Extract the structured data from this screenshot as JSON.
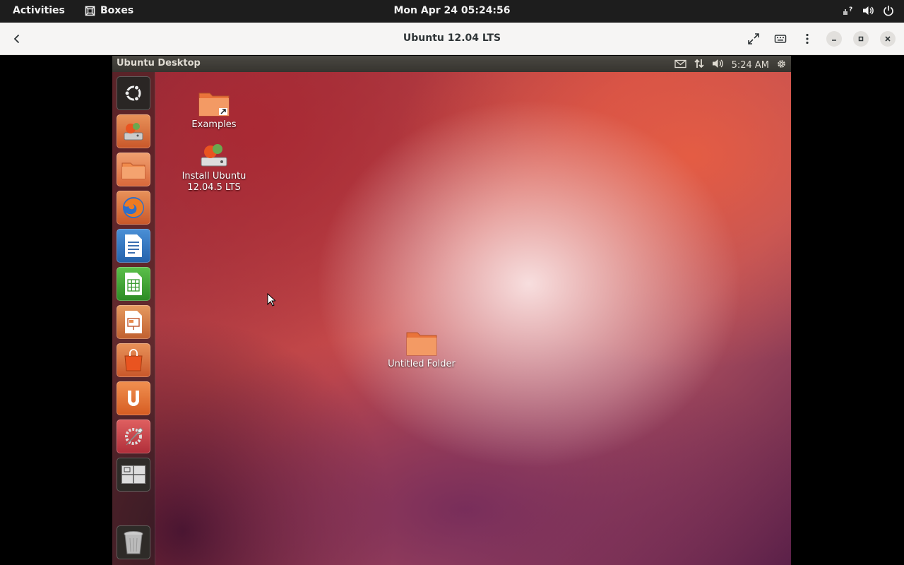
{
  "gnome_bar": {
    "activities": "Activities",
    "app_name": "Boxes",
    "clock": "Mon Apr 24  05:24:56"
  },
  "header": {
    "title": "Ubuntu 12.04 LTS"
  },
  "vm": {
    "panel_title": "Ubuntu Desktop",
    "panel_time": "5:24 AM",
    "launcher_items": [
      "dash-home",
      "install-ubuntu",
      "files",
      "firefox",
      "libreoffice-writer",
      "libreoffice-calc",
      "libreoffice-impress",
      "ubuntu-software-center",
      "ubuntu-one",
      "system-settings",
      "workspace-switcher",
      "trash"
    ],
    "desktop_icons": [
      {
        "label": "Examples"
      },
      {
        "label_line1": "Install Ubuntu",
        "label_line2": "12.04.5 LTS"
      },
      {
        "label": "Untitled Folder"
      }
    ]
  },
  "colors": {
    "gnome_bar": "#1d1d1d",
    "header_bg": "#f6f5f4",
    "ubuntu_orange": "#e95420"
  }
}
